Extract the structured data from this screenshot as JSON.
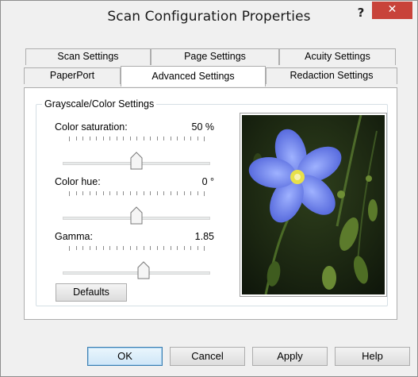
{
  "window": {
    "title": "Scan Configuration Properties",
    "help_label": "?",
    "close_label": "✕"
  },
  "tabs": {
    "row1": [
      {
        "label": "Scan Settings"
      },
      {
        "label": "Page Settings"
      },
      {
        "label": "Acuity Settings"
      }
    ],
    "row2": [
      {
        "label": "PaperPort"
      },
      {
        "label": "Advanced Settings",
        "active": true
      },
      {
        "label": "Redaction Settings"
      }
    ]
  },
  "group": {
    "title": "Grayscale/Color Settings",
    "sliders": [
      {
        "label": "Color saturation:",
        "value_text": "50 %",
        "position": 0.5
      },
      {
        "label": "Color hue:",
        "value_text": "0 °",
        "position": 0.5
      },
      {
        "label": "Gamma:",
        "value_text": "1.85",
        "position": 0.55
      }
    ],
    "defaults_label": "Defaults"
  },
  "preview": {
    "subject": "blue flax flower photo"
  },
  "footer": {
    "ok": "OK",
    "cancel": "Cancel",
    "apply": "Apply",
    "help": "Help"
  },
  "colors": {
    "close_button": "#c8433a",
    "dialog_bg": "#f0f0f0",
    "default_button_border": "#3c7fb1"
  }
}
